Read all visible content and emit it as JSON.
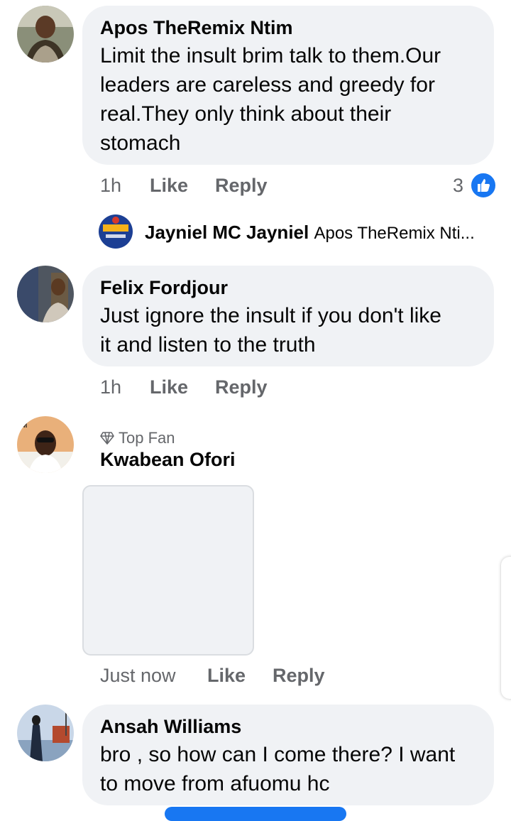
{
  "comments": [
    {
      "name": "Apos TheRemix Ntim",
      "lines": [
        "Limit the insult brim talk to them.Our",
        "leaders are careless and greedy for",
        "real.They only think about their",
        "stomach"
      ],
      "time": "1h",
      "like": "Like",
      "reply": "Reply",
      "reactions": "3",
      "reply_preview": {
        "name": "Jayniel MC Jayniel",
        "text": "Apos TheRemix Nti..."
      }
    },
    {
      "name": "Felix Fordjour",
      "lines": [
        "Just ignore the insult if you don't like",
        "it and listen to the truth"
      ],
      "time": "1h",
      "like": "Like",
      "reply": "Reply"
    },
    {
      "badge": "Top Fan",
      "name": "Kwabean Ofori",
      "time": "Just now",
      "like": "Like",
      "reply": "Reply"
    },
    {
      "name": "Ansah Williams",
      "lines": [
        "bro , so how can I come there? I want",
        "to move from afuomu hc"
      ]
    }
  ],
  "colors": {
    "bubble": "#f0f2f5",
    "meta_text": "#65676b",
    "like_blue": "#1877f2"
  }
}
